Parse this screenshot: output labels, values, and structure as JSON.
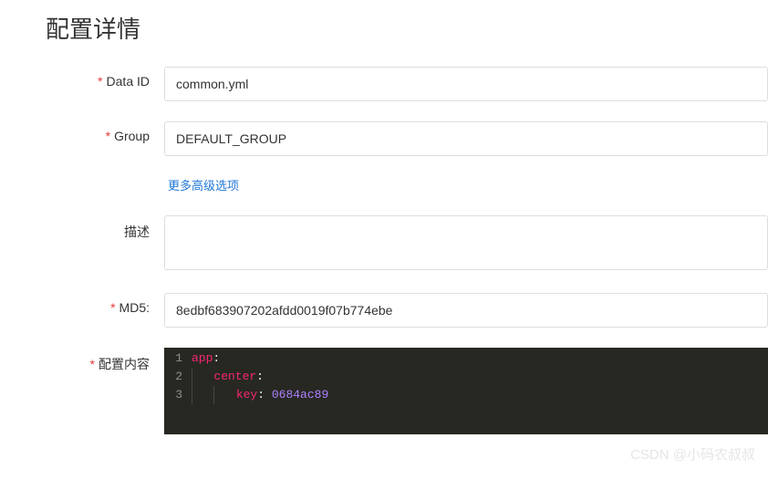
{
  "title": "配置详情",
  "labels": {
    "data_id": "Data ID",
    "group": "Group",
    "advanced": "更多高级选项",
    "description": "描述",
    "md5": "MD5:",
    "content": "配置内容"
  },
  "values": {
    "data_id": "common.yml",
    "group": "DEFAULT_GROUP",
    "description": "",
    "md5": "8edbf683907202afdd0019f07b774ebe"
  },
  "code": {
    "lines": [
      {
        "n": "1",
        "indent": 0,
        "key": "app",
        "value": null
      },
      {
        "n": "2",
        "indent": 1,
        "key": "center",
        "value": null
      },
      {
        "n": "3",
        "indent": 2,
        "key": "key",
        "value": "0684ac89"
      }
    ]
  },
  "watermark": "CSDN @小码农叔叔"
}
